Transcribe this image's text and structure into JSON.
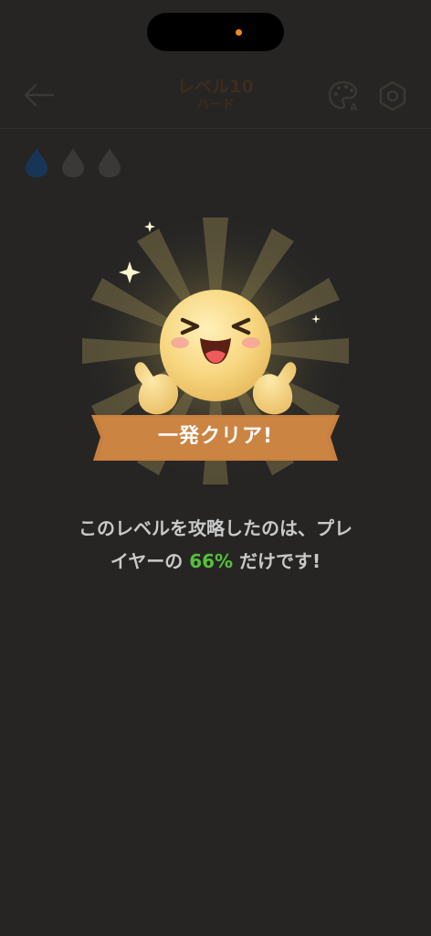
{
  "status": {
    "camera_dot_color": "#f08a1c"
  },
  "nav": {
    "back_icon": "arrow-left-icon",
    "title": "レベル10",
    "subtitle": "ハード",
    "palette_icon": "palette-icon",
    "palette_badge": "A",
    "settings_icon": "settings-gear-icon"
  },
  "hints": {
    "icon": "drop-icon",
    "total": 3,
    "filled": 1,
    "filled_color": "#173657",
    "empty_color": "#3a3938"
  },
  "result": {
    "badge_icon": "smiley-thumbs-up-icon",
    "banner_text": "一発クリア!",
    "banner_color": "#c8803f",
    "message_line1": "このレベルを攻略したのは、プレ",
    "message_line2_prefix": "イヤーの ",
    "percent": "66%",
    "message_line2_suffix": " だけです!",
    "percent_color": "#56c13a"
  }
}
